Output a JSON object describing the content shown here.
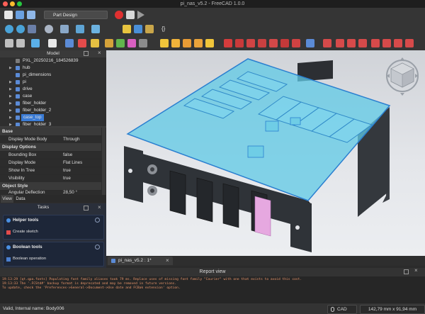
{
  "window": {
    "title": "pi_nas_v5.2 - FreeCAD 1.0.0"
  },
  "toolbar": {
    "workbench": "Part Design"
  },
  "model_panel": {
    "header": "Model",
    "tree": [
      {
        "label": "PXL_20250216_184526839",
        "type": "image",
        "expandable": false
      },
      {
        "label": "hub",
        "type": "part",
        "expandable": true
      },
      {
        "label": "pi_dimensions",
        "type": "part",
        "expandable": false
      },
      {
        "label": "pi",
        "type": "part",
        "expandable": true
      },
      {
        "label": "drive",
        "type": "part",
        "expandable": true
      },
      {
        "label": "case",
        "type": "part",
        "expandable": true
      },
      {
        "label": "fiber_holder",
        "type": "part",
        "expandable": true
      },
      {
        "label": "fiber_holder_2",
        "type": "part",
        "expandable": true
      },
      {
        "label": "case_top",
        "type": "part",
        "expandable": true,
        "selected": true
      },
      {
        "label": "fiber_holder_3",
        "type": "part",
        "expandable": true
      }
    ]
  },
  "properties": {
    "rows": [
      {
        "group": true,
        "key": "Base",
        "value": ""
      },
      {
        "group": false,
        "key": "Display Mode Body",
        "value": "Through"
      },
      {
        "group": true,
        "key": "Display Options",
        "value": ""
      },
      {
        "group": false,
        "key": "Bounding Box",
        "value": "false"
      },
      {
        "group": false,
        "key": "Display Mode",
        "value": "Flat Lines"
      },
      {
        "group": false,
        "key": "Show In Tree",
        "value": "true"
      },
      {
        "group": false,
        "key": "Visibility",
        "value": "true"
      },
      {
        "group": true,
        "key": "Object Style",
        "value": ""
      },
      {
        "group": false,
        "key": "Angular Deflection",
        "value": "28,50 °"
      }
    ],
    "tabs": [
      "View",
      "Data"
    ]
  },
  "tasks": {
    "header": "Tasks",
    "helper": {
      "title": "Helper tools",
      "item": "Create sketch"
    },
    "boolean": {
      "title": "Boolean tools",
      "item": "Boolean operation"
    }
  },
  "document_tab": {
    "label": "pi_nas_v5.2 : 1*"
  },
  "report": {
    "header": "Report view",
    "lines": [
      "19:13:29  [qt.qpa.fonts] Populating font family aliases took 79 ms. Replace uses of missing font family \"Courier\" with one that exists to avoid this cost.",
      "19:13:33  The '.FCStd#' backup format is deprecated and may be removed in future versions.",
      "To update, check the 'Preferences->General->Document->Use date and FCBak extension' option."
    ]
  },
  "status": {
    "left": "Valid, Internal name: Body006",
    "nav": "CAD",
    "dimensions": "142,79 mm x 91,94 mm"
  },
  "colors": {
    "accent_blue": "#3a7bd5",
    "selection_cyan": "#5fd0ea",
    "case_dark": "#2f3338",
    "report_text": "#e8956a"
  }
}
